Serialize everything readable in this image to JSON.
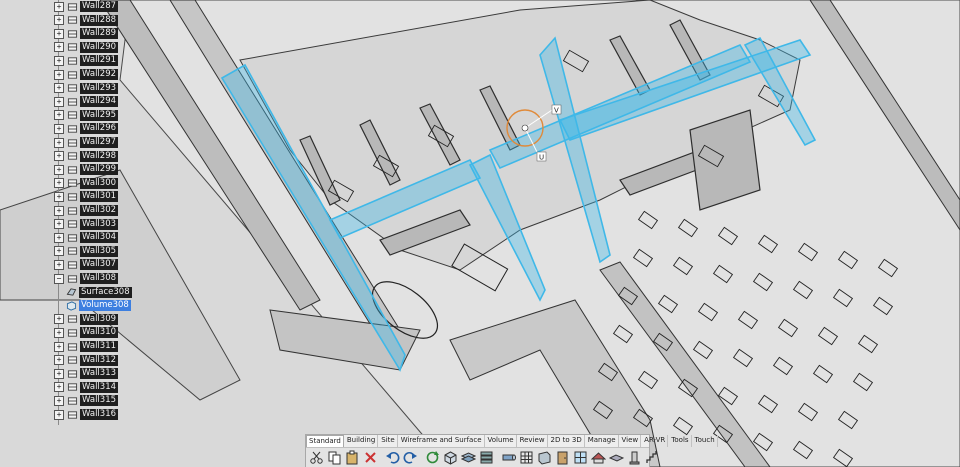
{
  "colors": {
    "background": "#d9d9d9",
    "selection": "#3fb8e8",
    "tree_label_bg": "#1f1f1f",
    "tree_selected_bg": "#3d7fe0"
  },
  "tree": {
    "items": [
      {
        "label": "Wall287",
        "expander": "+",
        "icon": "wall-icon",
        "indent": 0
      },
      {
        "label": "Wall288",
        "expander": "+",
        "icon": "wall-icon",
        "indent": 0
      },
      {
        "label": "Wall289",
        "expander": "+",
        "icon": "wall-icon",
        "indent": 0
      },
      {
        "label": "Wall290",
        "expander": "+",
        "icon": "wall-icon",
        "indent": 0
      },
      {
        "label": "Wall291",
        "expander": "+",
        "icon": "wall-icon",
        "indent": 0
      },
      {
        "label": "Wall292",
        "expander": "+",
        "icon": "wall-icon",
        "indent": 0
      },
      {
        "label": "Wall293",
        "expander": "+",
        "icon": "wall-icon",
        "indent": 0
      },
      {
        "label": "Wall294",
        "expander": "+",
        "icon": "wall-icon",
        "indent": 0
      },
      {
        "label": "Wall295",
        "expander": "+",
        "icon": "wall-icon",
        "indent": 0
      },
      {
        "label": "Wall296",
        "expander": "+",
        "icon": "wall-icon",
        "indent": 0
      },
      {
        "label": "Wall297",
        "expander": "+",
        "icon": "wall-icon",
        "indent": 0
      },
      {
        "label": "Wall298",
        "expander": "+",
        "icon": "wall-icon",
        "indent": 0
      },
      {
        "label": "Wall299",
        "expander": "+",
        "icon": "wall-icon",
        "indent": 0
      },
      {
        "label": "Wall300",
        "expander": "+",
        "icon": "wall-icon",
        "indent": 0
      },
      {
        "label": "Wall301",
        "expander": "+",
        "icon": "wall-icon",
        "indent": 0
      },
      {
        "label": "Wall302",
        "expander": "+",
        "icon": "wall-icon",
        "indent": 0
      },
      {
        "label": "Wall303",
        "expander": "+",
        "icon": "wall-icon",
        "indent": 0
      },
      {
        "label": "Wall304",
        "expander": "+",
        "icon": "wall-icon",
        "indent": 0
      },
      {
        "label": "Wall305",
        "expander": "+",
        "icon": "wall-icon",
        "indent": 0
      },
      {
        "label": "Wall307",
        "expander": "+",
        "icon": "wall-icon",
        "indent": 0
      },
      {
        "label": "Wall308",
        "expander": "−",
        "icon": "wall-icon",
        "indent": 0
      },
      {
        "label": "Surface308",
        "expander": "",
        "icon": "surface-icon",
        "indent": 1
      },
      {
        "label": "Volume308",
        "expander": "",
        "icon": "volume-icon",
        "indent": 1,
        "selected": true
      },
      {
        "label": "Wall309",
        "expander": "+",
        "icon": "wall-icon",
        "indent": 0
      },
      {
        "label": "Wall310",
        "expander": "+",
        "icon": "wall-icon",
        "indent": 0
      },
      {
        "label": "Wall311",
        "expander": "+",
        "icon": "wall-icon",
        "indent": 0
      },
      {
        "label": "Wall312",
        "expander": "+",
        "icon": "wall-icon",
        "indent": 0
      },
      {
        "label": "Wall313",
        "expander": "+",
        "icon": "wall-icon",
        "indent": 0
      },
      {
        "label": "Wall314",
        "expander": "+",
        "icon": "wall-icon",
        "indent": 0
      },
      {
        "label": "Wall315",
        "expander": "+",
        "icon": "wall-icon",
        "indent": 0
      },
      {
        "label": "Wall316",
        "expander": "+",
        "icon": "wall-icon",
        "indent": 0
      }
    ]
  },
  "ribbon": {
    "tabs": [
      "Standard",
      "Building",
      "Site",
      "Wireframe and Surface",
      "Volume",
      "Review",
      "2D to 3D",
      "Manage",
      "View",
      "AR-VR",
      "Tools",
      "Touch"
    ],
    "active_tab": "Standard",
    "tools": [
      "cut-icon",
      "copy-icon",
      "paste-icon",
      "delete-icon",
      "undo-icon",
      "redo-icon",
      "refresh-icon",
      "cube-icon",
      "layers-icon",
      "stack-icon",
      "pipe-icon",
      "grid-icon",
      "wall-icon",
      "door-icon",
      "window-icon",
      "roof-icon",
      "slab-icon",
      "column-icon",
      "stair-icon"
    ]
  },
  "viewport": {
    "manipulator_labels": [
      "V",
      "U"
    ]
  }
}
